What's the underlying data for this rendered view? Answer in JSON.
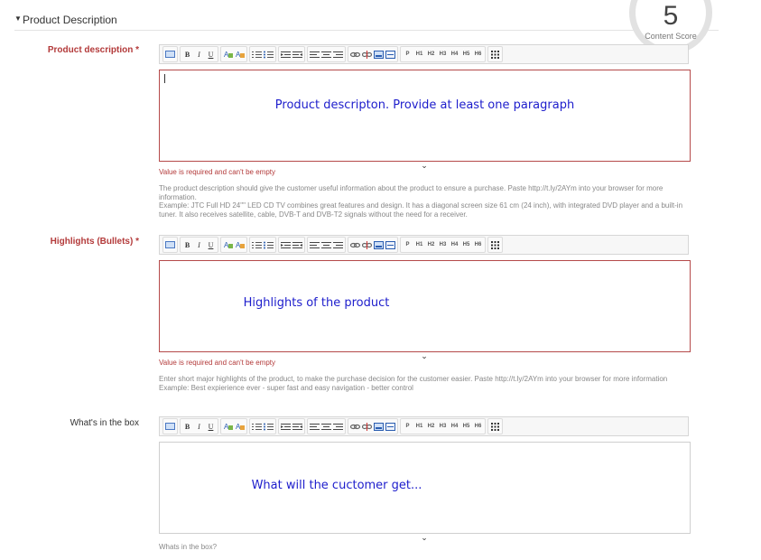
{
  "section": {
    "title": "Product Description",
    "caret": "▼"
  },
  "content_score": {
    "value": "5",
    "label": "Content Score"
  },
  "toolbar": {
    "buttons": {
      "bold": "B",
      "italic": "I",
      "underline": "U",
      "paragraph": "P",
      "h1": "H1",
      "h2": "H2",
      "h3": "H3",
      "h4": "H4",
      "h5": "H5",
      "h6": "H6"
    }
  },
  "fields": {
    "description": {
      "label": "Product description *",
      "placeholder": "Product descripton. Provide at least one paragraph",
      "error": "Value is required and can't be empty",
      "help_line1": "The product description should give the customer useful information about the product to ensure a purchase. Paste http://t.ly/2AYm into your browser for more information.",
      "help_line2": "Example: JTC Full HD 24\"\" LED CD TV combines great features and design. It has a diagonal screen size 61 cm (24 inch), with integrated DVD player and a built-in tuner. It also receives satellite, cable, DVB-T and DVB-T2 signals without the need for a receiver."
    },
    "highlights": {
      "label": "Highlights (Bullets) *",
      "placeholder": "Highlights of the product",
      "error": "Value is required and can't be empty",
      "help_line1": "Enter short major highlights of the product, to make the purchase decision for the customer easier. Paste http://t.ly/2AYm into your browser for more information",
      "help_line2": "Example: Best expierience ever - super fast and easy navigation - better control"
    },
    "in_the_box": {
      "label": "What's in the box",
      "placeholder": "What will the cuctomer get...",
      "help_line1": "Whats in the box?"
    }
  },
  "resize_glyph": "⌄",
  "colors": {
    "required_label": "#b33a3a",
    "placeholder": "#1d1dcc",
    "invalid_border": "#b54a4a"
  }
}
